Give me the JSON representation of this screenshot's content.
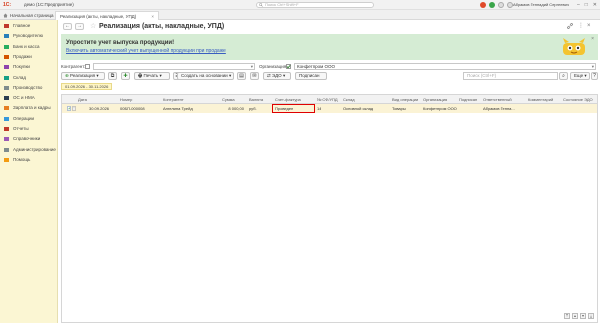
{
  "titlebar": {
    "logo": "1C:",
    "title": "демо (1С:Предприятие)",
    "search_placeholder": "Поиск Ctrl+Shift+F",
    "user": "Абрамов Геннадий Сергеевич",
    "controls": [
      "–",
      "□",
      "✕"
    ]
  },
  "tabs": {
    "home": "Начальная страница",
    "active": "Реализация (акты, накладные, УПД)",
    "close": "×"
  },
  "sidebar": {
    "items": [
      {
        "label": "Главное",
        "icon": "menu-icon"
      },
      {
        "label": "Руководителю",
        "icon": "chart-icon"
      },
      {
        "label": "Банк и касса",
        "icon": "bank-icon"
      },
      {
        "label": "Продажи",
        "icon": "cart-icon"
      },
      {
        "label": "Покупки",
        "icon": "basket-icon"
      },
      {
        "label": "Склад",
        "icon": "box-icon"
      },
      {
        "label": "Производство",
        "icon": "factory-icon"
      },
      {
        "label": "ОС и НМА",
        "icon": "assets-icon"
      },
      {
        "label": "Зарплата и кадры",
        "icon": "people-icon"
      },
      {
        "label": "Операции",
        "icon": "operations-icon"
      },
      {
        "label": "Отчеты",
        "icon": "report-icon"
      },
      {
        "label": "Справочники",
        "icon": "book-icon"
      },
      {
        "label": "Администрирование",
        "icon": "gear-icon"
      },
      {
        "label": "Помощь",
        "icon": "help-icon"
      }
    ]
  },
  "header": {
    "back": "←",
    "forward": "→",
    "star": "☆",
    "title": "Реализация (акты, накладные, УПД)",
    "link_icon": "🔗",
    "more_icon": "⋮",
    "close_icon": "×"
  },
  "banner": {
    "title": "Упростите учет выпуска продукции!",
    "link": "Включить автоматический учет выпущенной продукции при продаже",
    "close": "×"
  },
  "filters": {
    "kontragent_label": "Контрагент:",
    "kontragent_value": "",
    "org_label": "Организация:",
    "org_value": "Конфетпром ООО"
  },
  "toolbar": {
    "realizatsiya": "Реализация",
    "print": "Печать",
    "create_on_basis": "Создать на основании",
    "edo": "ЭДО",
    "sign": "Подписан",
    "search_placeholder": "Поиск (Ctrl+F)",
    "more": "Еще"
  },
  "period": "01.09.2026 - 30.11.2026",
  "table": {
    "columns": [
      "Дата",
      "Номер",
      "Контрагент",
      "Сумма",
      "Валюта",
      "Счет-фактура",
      "№ СФ/УПД",
      "Склад",
      "Вид операции",
      "Организация",
      "Подписан",
      "Ответственный",
      "Комментарий",
      "Состояние ЭДО"
    ],
    "rows": [
      {
        "date": "30.09.2026",
        "number": "00БП-000008",
        "contractor": "Ангелина Трейд",
        "sum": "8 000,00",
        "currency": "руб.",
        "invoice": "Проведен",
        "sf_number": "14",
        "warehouse": "Основной склад",
        "operation": "Товары",
        "organization": "Конфетпром ООО",
        "signed": "",
        "responsible": "Абрамов Генна...",
        "comment": "",
        "edo_state": ""
      }
    ]
  },
  "colors": {
    "sidebar_bg": "#fbf6d3",
    "banner_bg": "#d5ecd4",
    "selected_row": "#fbf3d5",
    "highlight": "#e00000",
    "link": "#3a5ec0"
  }
}
